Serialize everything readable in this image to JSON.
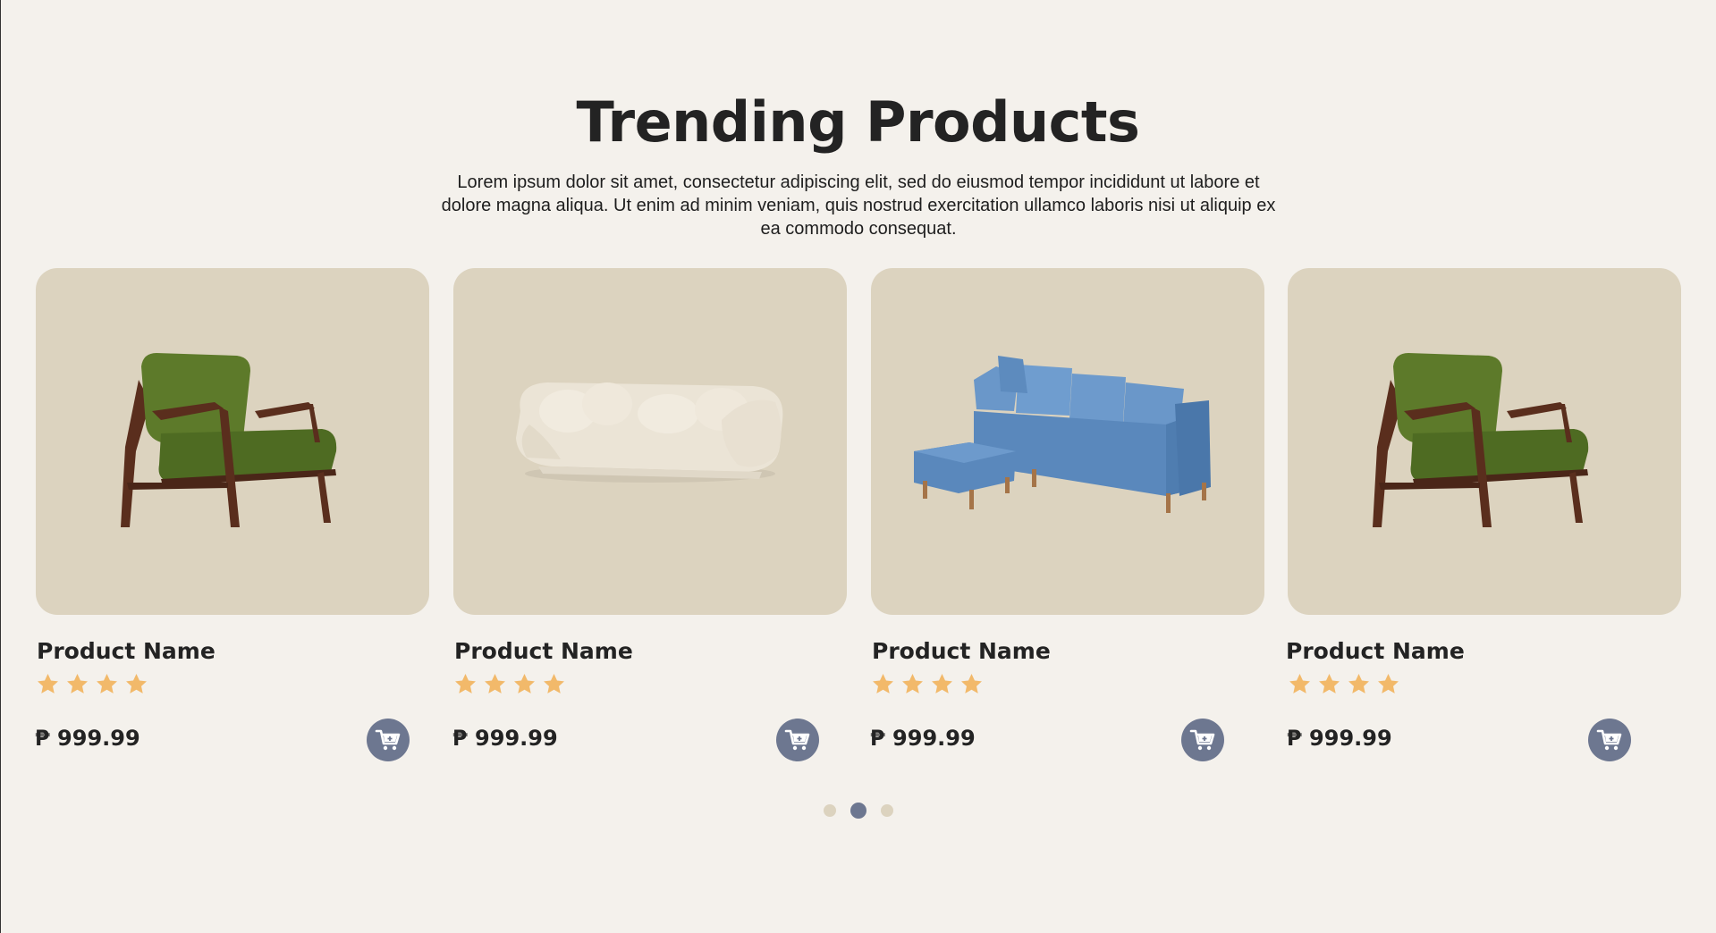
{
  "section": {
    "title": "Trending Products",
    "description": "Lorem ipsum dolor sit amet, consectetur adipiscing elit, sed do eiusmod tempor incididunt ut labore et dolore magna aliqua. Ut enim ad minim veniam, quis nostrud exercitation ullamco laboris nisi ut aliquip ex ea commodo consequat."
  },
  "products": [
    {
      "name": "Product Name",
      "price": "₱ 999.99",
      "rating": 4,
      "image": "green-armchair-image"
    },
    {
      "name": "Product Name",
      "price": "₱ 999.99",
      "rating": 4,
      "image": "cream-sofa-image"
    },
    {
      "name": "Product Name",
      "price": "₱ 999.99",
      "rating": 4,
      "image": "blue-sofa-ottoman-image"
    },
    {
      "name": "Product Name",
      "price": "₱ 999.99",
      "rating": 4,
      "image": "green-armchair-image"
    }
  ],
  "pagination": {
    "pages": 3,
    "active": 2
  },
  "colors": {
    "background": "#f4f1ec",
    "card": "#dcd3bf",
    "star": "#f2b96a",
    "accent": "#6d7790"
  },
  "icons": {
    "star": "star-icon",
    "cart": "cart-plus-icon"
  }
}
